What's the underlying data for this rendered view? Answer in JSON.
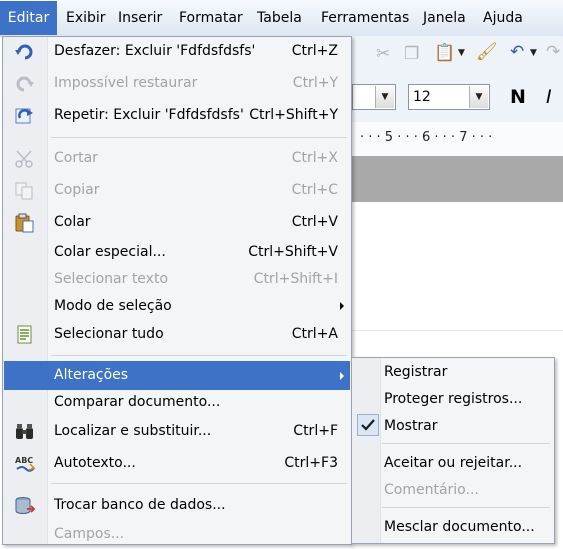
{
  "menubar": {
    "items": [
      {
        "label": "Editar",
        "active": true
      },
      {
        "label": "Exibir"
      },
      {
        "label": "Inserir"
      },
      {
        "label": "Formatar"
      },
      {
        "label": "Tabela"
      },
      {
        "label": "Ferramentas"
      },
      {
        "label": "Janela"
      },
      {
        "label": "Ajuda"
      }
    ]
  },
  "toolbar": {
    "font_size_value": "12",
    "bold_label": "N",
    "italic_label": "I"
  },
  "ruler": {
    "marks": "· · · 5 · · · 6 · · · 7 · · ·"
  },
  "edit_menu": {
    "items": [
      {
        "label": "Desfazer: Excluir 'Fdfdsfdsfs'",
        "shortcut": "Ctrl+Z",
        "icon": "undo-icon",
        "enabled": true
      },
      {
        "label": "Impossível restaurar",
        "shortcut": "Ctrl+Y",
        "icon": "restore-icon",
        "enabled": false
      },
      {
        "label": "Repetir: Excluir 'Fdfdsfdsfs'",
        "shortcut": "Ctrl+Shift+Y",
        "icon": "repeat-icon",
        "enabled": true
      },
      {
        "label": "Cortar",
        "shortcut": "Ctrl+X",
        "icon": "scissors-icon",
        "enabled": false
      },
      {
        "label": "Copiar",
        "shortcut": "Ctrl+C",
        "icon": "copy-icon",
        "enabled": false
      },
      {
        "label": "Colar",
        "shortcut": "Ctrl+V",
        "icon": "paste-icon",
        "enabled": true
      },
      {
        "label": "Colar especial...",
        "shortcut": "Ctrl+Shift+V",
        "enabled": true
      },
      {
        "label": "Selecionar texto",
        "shortcut": "Ctrl+Shift+I",
        "enabled": false
      },
      {
        "label": "Modo de seleção",
        "submenu": true,
        "enabled": true
      },
      {
        "label": "Selecionar tudo",
        "shortcut": "Ctrl+A",
        "icon": "select-all-icon",
        "enabled": true
      },
      {
        "label": "Alterações",
        "submenu": true,
        "highlighted": true,
        "enabled": true
      },
      {
        "label": "Comparar documento...",
        "enabled": true
      },
      {
        "label": "Localizar e substituir...",
        "shortcut": "Ctrl+F",
        "icon": "binoculars-icon",
        "enabled": true
      },
      {
        "label": "Autotexto...",
        "shortcut": "Ctrl+F3",
        "icon": "autotext-icon",
        "enabled": true
      },
      {
        "label": "Trocar banco de dados...",
        "icon": "database-icon",
        "enabled": true
      },
      {
        "label": "Campos...",
        "enabled": false
      }
    ]
  },
  "changes_submenu": {
    "items": [
      {
        "label": "Registrar",
        "enabled": true
      },
      {
        "label": "Proteger registros...",
        "enabled": true
      },
      {
        "label": "Mostrar",
        "checked": true,
        "enabled": true
      },
      {
        "label": "Aceitar ou rejeitar...",
        "enabled": true
      },
      {
        "label": "Comentário...",
        "enabled": false
      },
      {
        "label": "Mesclar documento...",
        "enabled": true
      }
    ]
  },
  "colors": {
    "highlight": "#3d72c6",
    "disabled_text": "#a0a4a9",
    "menu_bg": "#f4f5f7"
  }
}
